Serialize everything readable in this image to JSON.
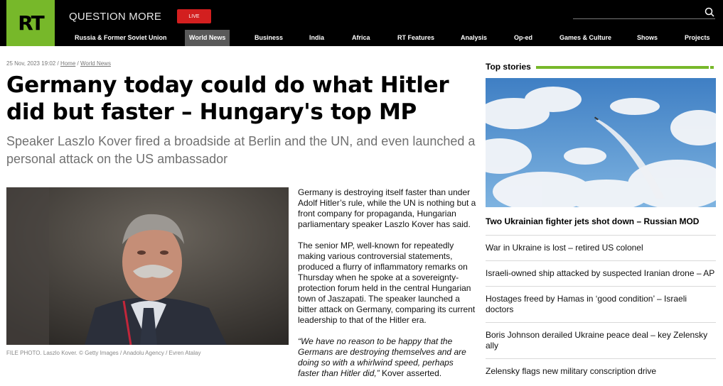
{
  "header": {
    "logo_text": "RT",
    "brand_title": "QUESTION MORE",
    "live_label": "LIVE",
    "search_icon": "search-icon",
    "accent_color": "#77b82a"
  },
  "nav": {
    "items": [
      {
        "label": "Russia & Former Soviet Union"
      },
      {
        "label": "World News",
        "active": true
      },
      {
        "label": "Business"
      },
      {
        "label": "India"
      },
      {
        "label": "Africa"
      },
      {
        "label": "RT Features"
      },
      {
        "label": "Analysis"
      },
      {
        "label": "Op-ed"
      },
      {
        "label": "Games & Culture"
      },
      {
        "label": "Shows"
      },
      {
        "label": "Projects"
      }
    ]
  },
  "article": {
    "date": "25 Nov, 2023 19:02",
    "breadcrumb": [
      "Home",
      "World News"
    ],
    "headline": "Germany today could do what Hitler did but faster – Hungary's top MP",
    "subhead": "Speaker Laszlo Kover fired a broadside at Berlin and the UN, and even launched a personal attack on the US ambassador",
    "photo_caption": "FILE PHOTO. Laszlo Kover. ©  Getty Images / Anadolu Agency / Evren Atalay",
    "paragraphs": [
      "Germany is destroying itself faster than under Adolf Hitler’s rule, while the UN is nothing but a front company for propaganda, Hungarian parliamentary speaker Laszlo Kover has said.",
      "The senior MP, well-known for repeatedly making various controversial statements, produced a flurry of inflammatory remarks on Thursday when he spoke at a sovereignty-protection forum held in the central Hungarian town of Jaszapati. The speaker launched a bitter attack on Germany, comparing its current leadership to that of the Hitler era."
    ],
    "quote": "“We have no reason to be happy that the Germans are destroying themselves and are doing so with a whirlwind speed, perhaps faster than Hitler did,”",
    "quote_attribution": " Kover asserted."
  },
  "top_stories": {
    "title": "Top stories",
    "lead": "Two Ukrainian fighter jets shot down – Russian MOD",
    "items": [
      "War in Ukraine is lost – retired US colonel",
      "Israeli-owned ship attacked by suspected Iranian drone – AP",
      "Hostages freed by Hamas in ‘good condition’ – Israeli doctors",
      "Boris Johnson derailed Ukraine peace deal – key Zelensky ally",
      "Zelensky flags new military conscription drive"
    ]
  }
}
